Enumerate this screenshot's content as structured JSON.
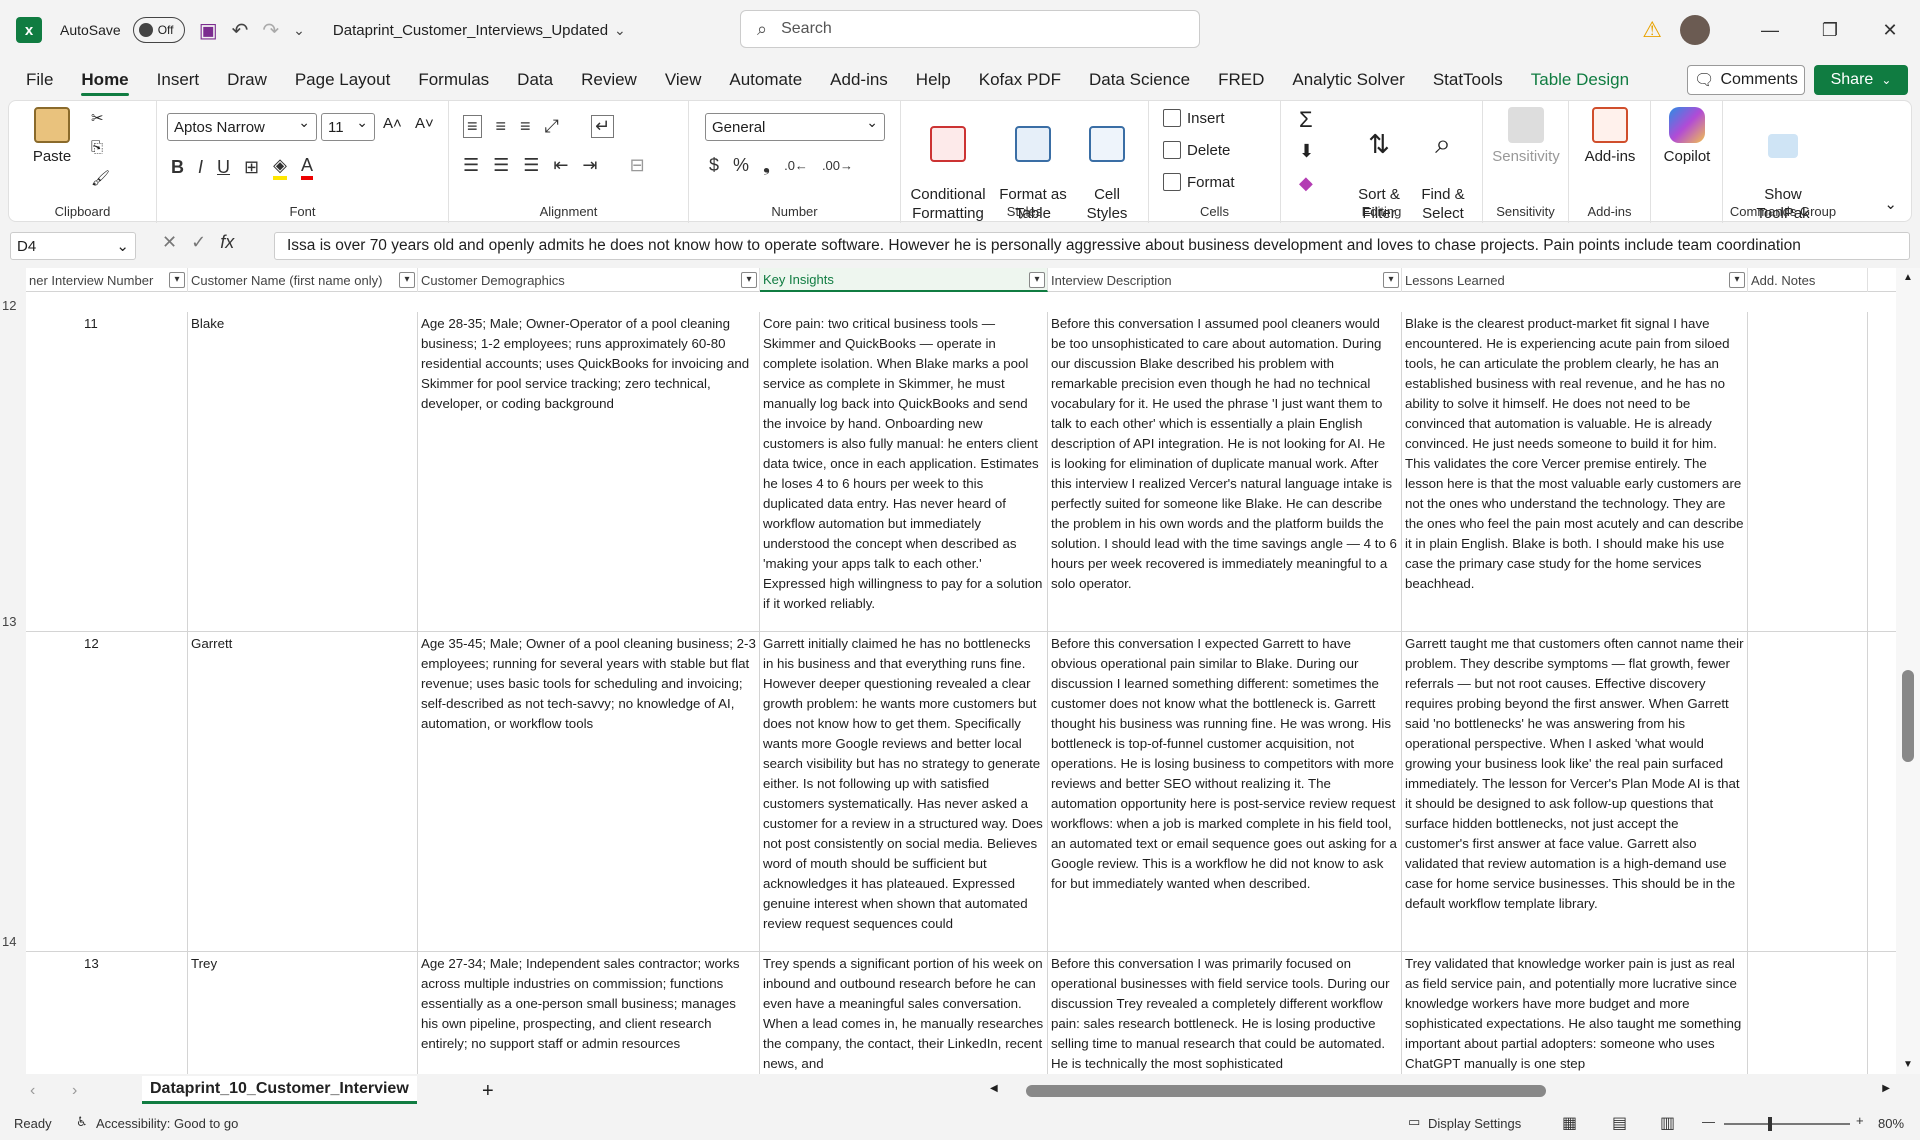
{
  "titlebar": {
    "autosave_label": "AutoSave",
    "autosave_state": "Off",
    "filename": "Dataprint_Customer_Interviews_Updated",
    "search_placeholder": "Search"
  },
  "ribbon_tabs": [
    "File",
    "Home",
    "Insert",
    "Draw",
    "Page Layout",
    "Formulas",
    "Data",
    "Review",
    "View",
    "Automate",
    "Add-ins",
    "Help",
    "Kofax PDF",
    "Data Science",
    "FRED",
    "Analytic Solver",
    "StatTools",
    "Table Design"
  ],
  "active_tab": "Home",
  "comments_label": "Comments",
  "share_label": "Share",
  "ribbon": {
    "clipboard": {
      "label": "Clipboard",
      "paste": "Paste"
    },
    "font": {
      "label": "Font",
      "family": "Aptos Narrow",
      "size": "11"
    },
    "alignment": {
      "label": "Alignment"
    },
    "number": {
      "label": "Number",
      "format": "General"
    },
    "styles": {
      "label": "Styles",
      "conditional": "Conditional\nFormatting",
      "format_table": "Format as\nTable",
      "cell_styles": "Cell\nStyles"
    },
    "cells": {
      "label": "Cells",
      "insert": "Insert",
      "delete": "Delete",
      "format": "Format"
    },
    "editing": {
      "label": "Editing",
      "sort": "Sort &\nFilter",
      "find": "Find &\nSelect"
    },
    "sensitivity": {
      "label": "Sensitivity",
      "button": "Sensitivity"
    },
    "addins": {
      "label": "Add-ins",
      "button": "Add-ins"
    },
    "copilot": {
      "button": "Copilot"
    },
    "commands": {
      "label": "Commands Group",
      "button": "Show\nToolPak"
    }
  },
  "formula_bar": {
    "name_box": "D4",
    "formula": "Issa is over 70 years old and openly admits he does not know how to operate software. However he is personally aggressive about business development and loves to chase projects. Pain points include team coordination"
  },
  "columns": [
    {
      "label": "ner Interview Number"
    },
    {
      "label": "Customer Name (first name only)"
    },
    {
      "label": "Customer Demographics"
    },
    {
      "label": "Key Insights"
    },
    {
      "label": "Interview Description"
    },
    {
      "label": "Lessons Learned"
    },
    {
      "label": "Add. Notes"
    }
  ],
  "row_headers": [
    "12",
    "13",
    "14"
  ],
  "rows": [
    {
      "num": "11",
      "name": "Blake",
      "demographics": "Age 28-35; Male; Owner-Operator of a pool cleaning business; 1-2 employees; runs approximately 60-80 residential accounts; uses QuickBooks for invoicing and Skimmer for pool service tracking; zero technical, developer, or coding background",
      "insights": "Core pain: two critical business tools — Skimmer and QuickBooks — operate in complete isolation. When Blake marks a pool service as complete in Skimmer, he must manually log back into QuickBooks and send the invoice by hand. Onboarding new customers is also fully manual: he enters client data twice, once in each application. Estimates he loses 4 to 6 hours per week to this duplicated data entry. Has never heard of workflow automation but immediately understood the concept when described as 'making your apps talk to each other.' Expressed high willingness to pay for a solution if it worked reliably.",
      "description": "Before this conversation I assumed pool cleaners would be too unsophisticated to care about automation. During our discussion Blake described his problem with remarkable precision even though he had no technical vocabulary for it. He used the phrase 'I just want them to talk to each other' which is essentially a plain English description of API integration. He is not looking for AI. He is looking for elimination of duplicate manual work. After this interview I realized Vercer's natural language intake is perfectly suited for someone like Blake. He can describe the problem in his own words and the platform builds the solution. I should lead with the time savings angle — 4 to 6 hours per week recovered is immediately meaningful to a solo operator.",
      "lessons": "Blake is the clearest product-market fit signal I have encountered. He is experiencing acute pain from siloed tools, he can articulate the problem clearly, he has an established business with real revenue, and he has no ability to solve it himself. He does not need to be convinced that automation is valuable. He is already convinced. He just needs someone to build it for him. This validates the core Vercer premise entirely. The lesson here is that the most valuable early customers are not the ones who understand the technology. They are the ones who feel the pain most acutely and can describe it in plain English. Blake is both. I should make his use case the primary case study for the home services beachhead.",
      "notes": ""
    },
    {
      "num": "12",
      "name": "Garrett",
      "demographics": "Age 35-45; Male; Owner of a pool cleaning business; 2-3 employees; running for several years with stable but flat revenue; uses basic tools for scheduling and invoicing; self-described as not tech-savvy; no knowledge of AI, automation, or workflow tools",
      "insights": "Garrett initially claimed he has no bottlenecks in his business and that everything runs fine. However deeper questioning revealed a clear growth problem: he wants more customers but does not know how to get them. Specifically wants more Google reviews and better local search visibility but has no strategy to generate either. Is not following up with satisfied customers systematically. Has never asked a customer for a review in a structured way. Does not post consistently on social media. Believes word of mouth should be sufficient but acknowledges it has plateaued. Expressed genuine interest when shown that automated review request sequences could",
      "description": "Before this conversation I expected Garrett to have obvious operational pain similar to Blake. During our discussion I learned something different: sometimes the customer does not know what the bottleneck is. Garrett thought his business was running fine. He was wrong. His bottleneck is top-of-funnel customer acquisition, not operations. He is losing business to competitors with more reviews and better SEO without realizing it. The automation opportunity here is post-service review request workflows: when a job is marked complete in his field tool, an automated text or email sequence goes out asking for a Google review. This is a workflow he did not know to ask for but immediately wanted when described.",
      "lessons": "Garrett taught me that customers often cannot name their problem. They describe symptoms — flat growth, fewer referrals — but not root causes. Effective discovery requires probing beyond the first answer. When Garrett said 'no bottlenecks' he was answering from his operational perspective. When I asked 'what would growing your business look like' the real pain surfaced immediately. The lesson for Vercer's Plan Mode AI is that it should be designed to ask follow-up questions that surface hidden bottlenecks, not just accept the customer's first answer at face value. Garrett also validated that review automation is a high-demand use case for home service businesses. This should be in the default workflow template library.",
      "notes": ""
    },
    {
      "num": "13",
      "name": "Trey",
      "demographics": "Age 27-34; Male; Independent sales contractor; works across multiple industries on commission; functions essentially as a one-person small business; manages his own pipeline, prospecting, and client research entirely; no support staff or admin resources",
      "insights": "Trey spends a significant portion of his week on inbound and outbound research before he can even have a meaningful sales conversation. When a lead comes in, he manually researches the company, the contact, their LinkedIn, recent news, and",
      "description": "Before this conversation I was primarily focused on operational businesses with field service tools. During our discussion Trey revealed a completely different workflow pain: sales research bottleneck. He is losing productive selling time to manual research that could be automated. He is technically the most sophisticated",
      "lessons": "Trey validated that knowledge worker pain is just as real as field service pain, and potentially more lucrative since knowledge workers have more budget and more sophisticated expectations. He also taught me something important about partial adopters: someone who uses ChatGPT manually is one step",
      "notes": ""
    }
  ],
  "sheet_tab": "Dataprint_10_Customer_Interview",
  "status": {
    "ready": "Ready",
    "accessibility": "Accessibility: Good to go",
    "display_settings": "Display Settings",
    "zoom": "80%"
  }
}
